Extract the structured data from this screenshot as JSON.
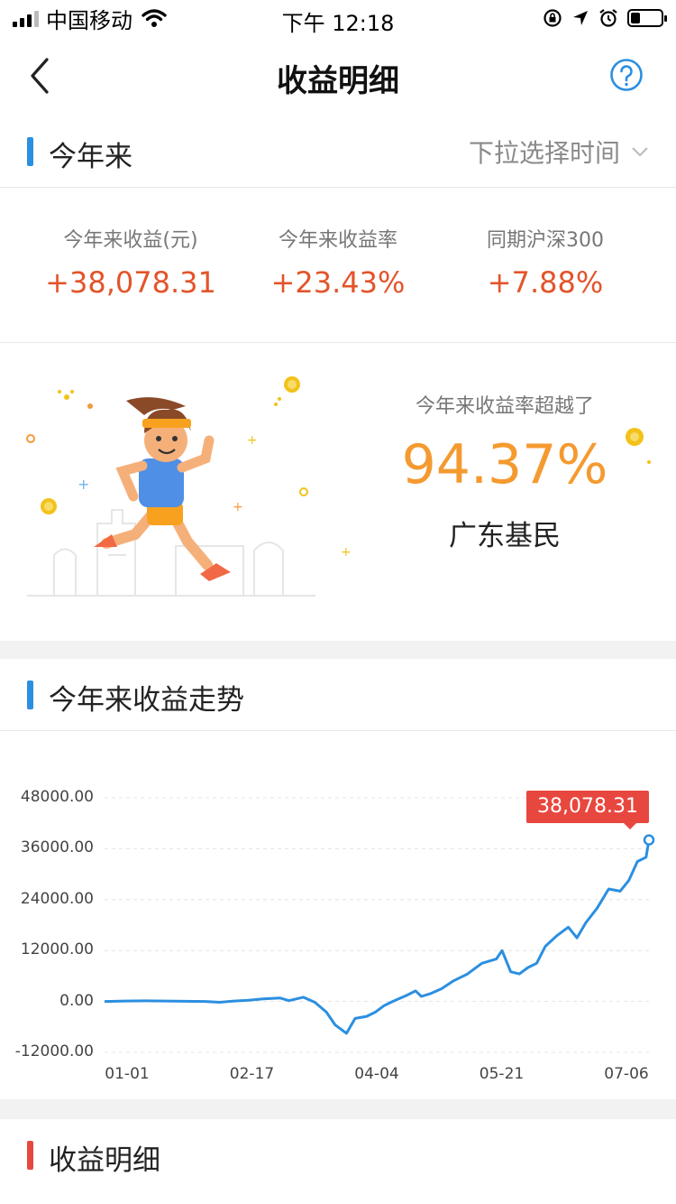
{
  "status_bar": {
    "carrier": "中国移动",
    "time": "下午 12:18",
    "battery_level": 0.3
  },
  "nav": {
    "title": "收益明细",
    "back_icon": "chevron-left-icon",
    "help_icon": "question-circle-icon"
  },
  "period": {
    "title": "今年来",
    "picker_label": "下拉选择时间"
  },
  "stats": [
    {
      "label": "今年来收益(元)",
      "value": "+38,078.31"
    },
    {
      "label": "今年来收益率",
      "value": "+23.43%"
    },
    {
      "label": "同期沪深300",
      "value": "+7.88%"
    }
  ],
  "banner": {
    "subtitle": "今年来收益率超越了",
    "percent": "94.37%",
    "region": "广东基民"
  },
  "trend": {
    "title": "今年来收益走势"
  },
  "detail": {
    "title": "收益明细"
  },
  "colors": {
    "accent_blue": "#2b8fe0",
    "profit_red": "#e3542a",
    "banner_orange": "#f49a30",
    "tooltip_red": "#e8473f"
  },
  "chart_data": {
    "type": "line",
    "title": "",
    "xlabel": "",
    "ylabel": "",
    "x_ticks": [
      "01-01",
      "02-17",
      "04-04",
      "05-21",
      "07-06"
    ],
    "y_ticks": [
      "48000.00",
      "36000.00",
      "24000.00",
      "12000.00",
      "0.00",
      "-12000.00"
    ],
    "ylim": [
      -12000,
      48000
    ],
    "grid": true,
    "highlight_label": "38,078.31",
    "series": [
      {
        "values": [
          [
            "01-01",
            0
          ],
          [
            "01-08",
            100
          ],
          [
            "01-15",
            150
          ],
          [
            "01-22",
            100
          ],
          [
            "01-29",
            50
          ],
          [
            "02-05",
            0
          ],
          [
            "02-10",
            -200
          ],
          [
            "02-15",
            100
          ],
          [
            "02-20",
            300
          ],
          [
            "02-25",
            600
          ],
          [
            "03-02",
            800
          ],
          [
            "03-05",
            200
          ],
          [
            "03-10",
            1000
          ],
          [
            "03-14",
            -200
          ],
          [
            "03-18",
            -2500
          ],
          [
            "03-21",
            -5500
          ],
          [
            "03-25",
            -7500
          ],
          [
            "03-28",
            -4000
          ],
          [
            "04-01",
            -3500
          ],
          [
            "04-04",
            -2500
          ],
          [
            "04-07",
            -1000
          ],
          [
            "04-10",
            0
          ],
          [
            "04-15",
            1500
          ],
          [
            "04-18",
            2500
          ],
          [
            "04-20",
            1200
          ],
          [
            "04-23",
            1800
          ],
          [
            "04-27",
            3000
          ],
          [
            "05-01",
            4800
          ],
          [
            "05-06",
            6500
          ],
          [
            "05-11",
            9000
          ],
          [
            "05-16",
            10000
          ],
          [
            "05-18",
            12000
          ],
          [
            "05-21",
            7000
          ],
          [
            "05-24",
            6500
          ],
          [
            "05-27",
            8000
          ],
          [
            "05-30",
            9000
          ],
          [
            "06-02",
            13000
          ],
          [
            "06-06",
            15500
          ],
          [
            "06-10",
            17500
          ],
          [
            "06-13",
            15000
          ],
          [
            "06-16",
            18500
          ],
          [
            "06-20",
            22000
          ],
          [
            "06-24",
            26500
          ],
          [
            "06-28",
            26000
          ],
          [
            "07-01",
            28500
          ],
          [
            "07-04",
            33000
          ],
          [
            "07-07",
            34000
          ],
          [
            "07-08",
            38078.31
          ]
        ]
      }
    ]
  }
}
